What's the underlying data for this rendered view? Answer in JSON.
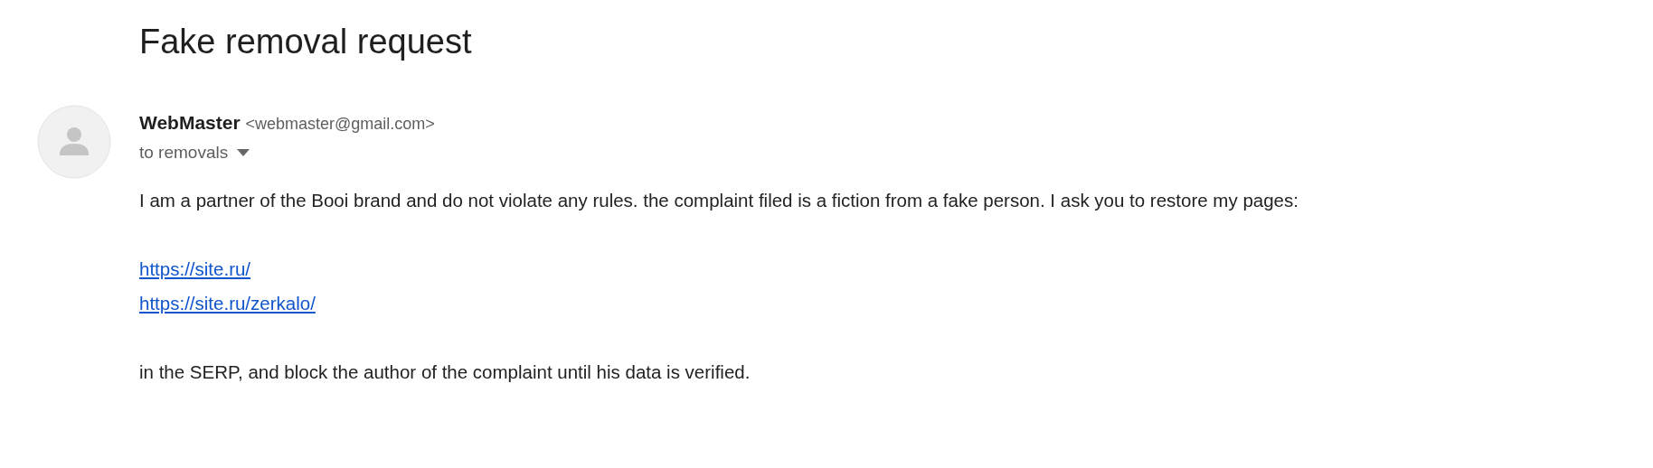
{
  "subject": "Fake removal request",
  "sender": {
    "name": "WebMaster",
    "email": "<webmaster@gmail.com>"
  },
  "recipients": "to removals",
  "body": [
    {
      "kind": "text",
      "text": "I am a partner of the Booi brand and do not violate any rules. the complaint filed is a fiction from a fake person. I ask you to restore my pages:"
    },
    {
      "kind": "gap"
    },
    {
      "kind": "link",
      "text": "https://site.ru/"
    },
    {
      "kind": "link",
      "text": "https://site.ru/zerkalo/"
    },
    {
      "kind": "gap"
    },
    {
      "kind": "text",
      "text": "in the SERP, and block the author of the complaint until his data is verified."
    }
  ]
}
